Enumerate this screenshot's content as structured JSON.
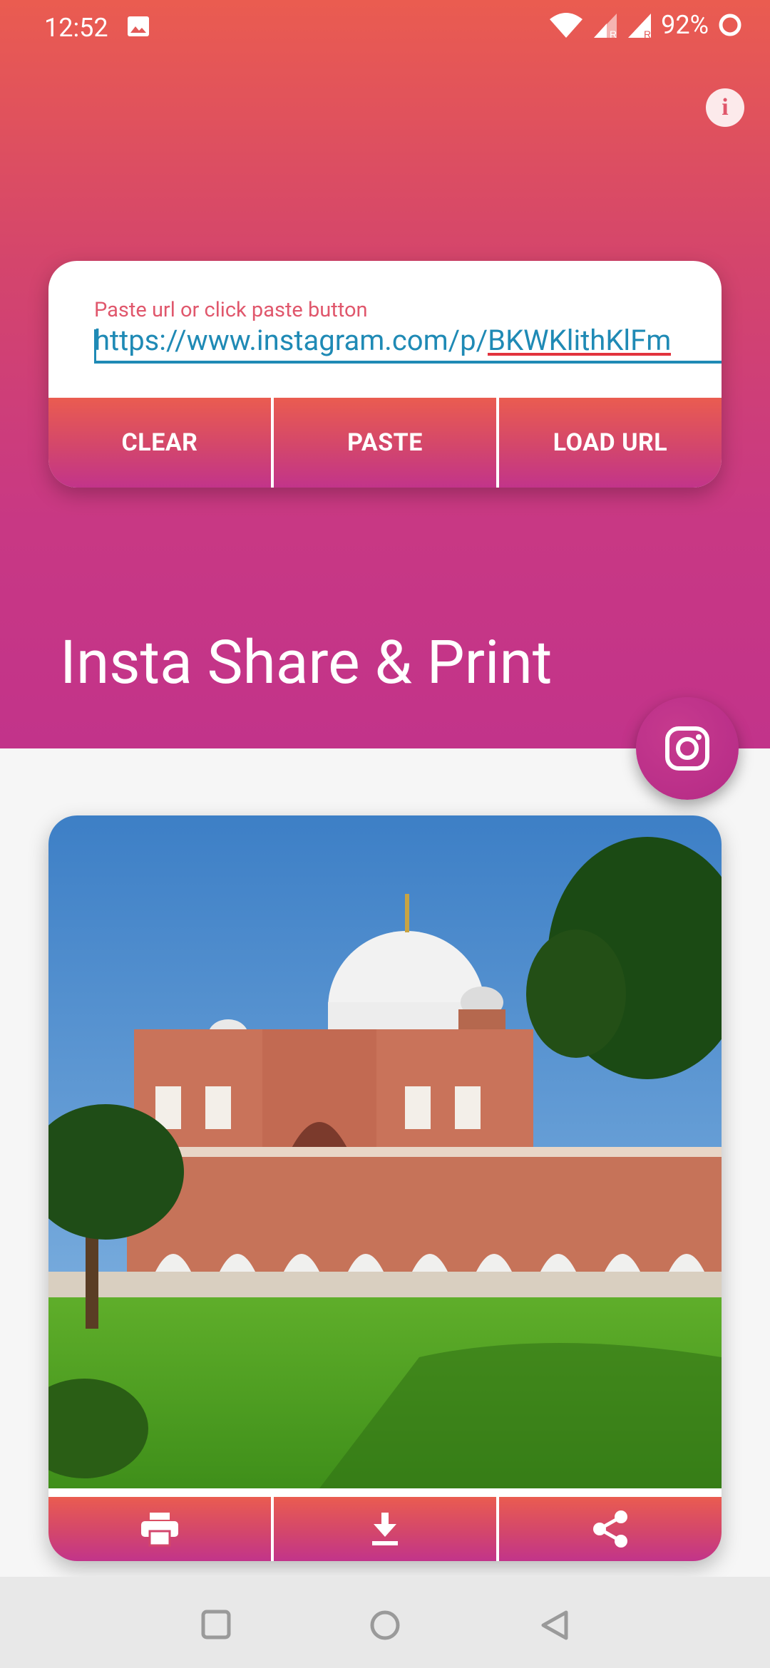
{
  "status_bar": {
    "time": "12:52",
    "battery_percent": "92%",
    "icons": [
      "image-icon",
      "wifi-icon",
      "signal-icon",
      "signal-icon",
      "battery-ring-icon"
    ]
  },
  "url_card": {
    "hint": "Paste url or click paste button",
    "url_value": "https://www.instagram.com/p/",
    "url_misspelled_part": "BKWKlithKlFm"
  },
  "actions": {
    "clear": "CLEAR",
    "paste": "PASTE",
    "load_url": "LOAD URL"
  },
  "app": {
    "title": "Insta Share & Print"
  },
  "photo_actions": [
    "print-icon",
    "download-icon",
    "share-icon"
  ],
  "nav_bar": [
    "recents-square",
    "home-circle",
    "back-triangle"
  ],
  "colors": {
    "gradient_top": "#ea5c50",
    "gradient_bottom": "#c2338a",
    "link_blue": "#1f8ab5",
    "hint_red": "#e0576c"
  }
}
